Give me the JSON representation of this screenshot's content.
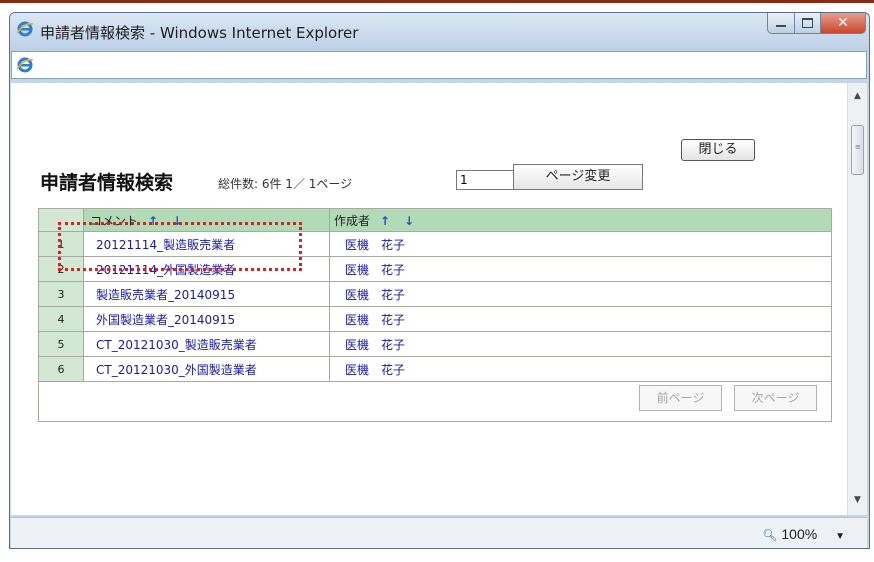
{
  "window": {
    "title": "申請者情報検索 - Windows Internet Explorer"
  },
  "status": {
    "zoom": "100%"
  },
  "page": {
    "close_label": "閉じる",
    "title": "申請者情報検索",
    "summary": "総件数: 6件 1／ 1ページ",
    "page_input_value": "1",
    "page_change_label": "ページ変更"
  },
  "table": {
    "headers": {
      "comment": "コメント",
      "author": "作成者"
    },
    "sort_up": "↑",
    "sort_down": "↓",
    "rows": [
      {
        "no": "1",
        "comment": "20121114_製造販売業者",
        "author": "医機　花子"
      },
      {
        "no": "2",
        "comment": "20121114_外国製造業者",
        "author": "医機　花子"
      },
      {
        "no": "3",
        "comment": "製造販売業者_20140915",
        "author": "医機　花子"
      },
      {
        "no": "4",
        "comment": "外国製造業者_20140915",
        "author": "医機　花子"
      },
      {
        "no": "5",
        "comment": "CT_20121030_製造販売業者",
        "author": "医機　花子"
      },
      {
        "no": "6",
        "comment": "CT_20121030_外国製造業者",
        "author": "医機　花子"
      }
    ],
    "prev_label": "前ページ",
    "next_label": "次ページ"
  },
  "colors": {
    "header_bg": "#b3dab7",
    "number_bg": "#d2e8d2",
    "link": "#1a1aa8",
    "highlight": "#e01e1e"
  },
  "icons": [
    "ie-logo-icon",
    "minimize-icon",
    "maximize-icon",
    "close-icon",
    "zoom-icon",
    "scroll-up-icon",
    "scroll-down-icon"
  ]
}
